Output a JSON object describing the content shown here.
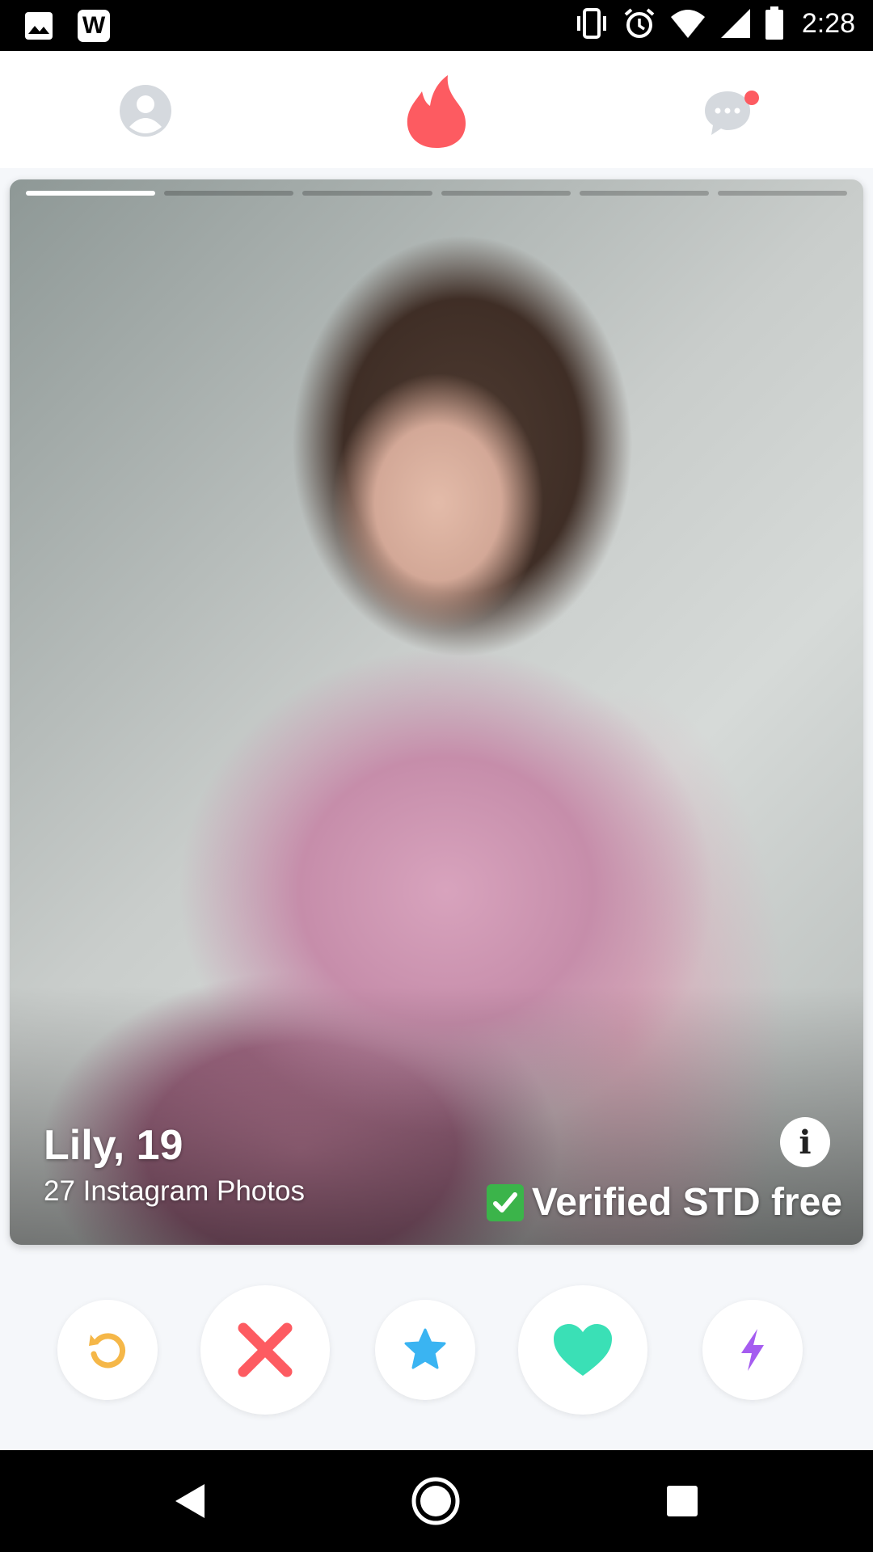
{
  "status_bar": {
    "time": "2:28",
    "icons": [
      "image-icon",
      "w-app-icon",
      "vibrate-icon",
      "alarm-icon",
      "wifi-icon",
      "cell-signal-icon",
      "battery-icon"
    ],
    "w_label": "W"
  },
  "top_nav": {
    "items": [
      "profile-icon",
      "flame-logo-icon",
      "chat-icon"
    ],
    "brand_color": "#fd5b61",
    "inactive_color": "#d5d9de",
    "notification_dot_color": "#fd5b61"
  },
  "card": {
    "name_age": "Lily, 19",
    "subtitle": "27 Instagram Photos",
    "verified_text": "Verified STD free",
    "info_label": "i",
    "photo_count": 6,
    "active_photo": 1
  },
  "actions": {
    "buttons": [
      {
        "name": "rewind-button",
        "icon": "rewind-icon",
        "color": "#f5b748"
      },
      {
        "name": "nope-button",
        "icon": "x-icon",
        "color": "#fd5b61"
      },
      {
        "name": "super-like-button",
        "icon": "star-icon",
        "color": "#3ab4f2"
      },
      {
        "name": "like-button",
        "icon": "heart-icon",
        "color": "#3ae0b6"
      },
      {
        "name": "boost-button",
        "icon": "lightning-icon",
        "color": "#a55cf0"
      }
    ]
  },
  "nav_bar": {
    "items": [
      "back-icon",
      "home-icon",
      "recents-icon"
    ]
  }
}
